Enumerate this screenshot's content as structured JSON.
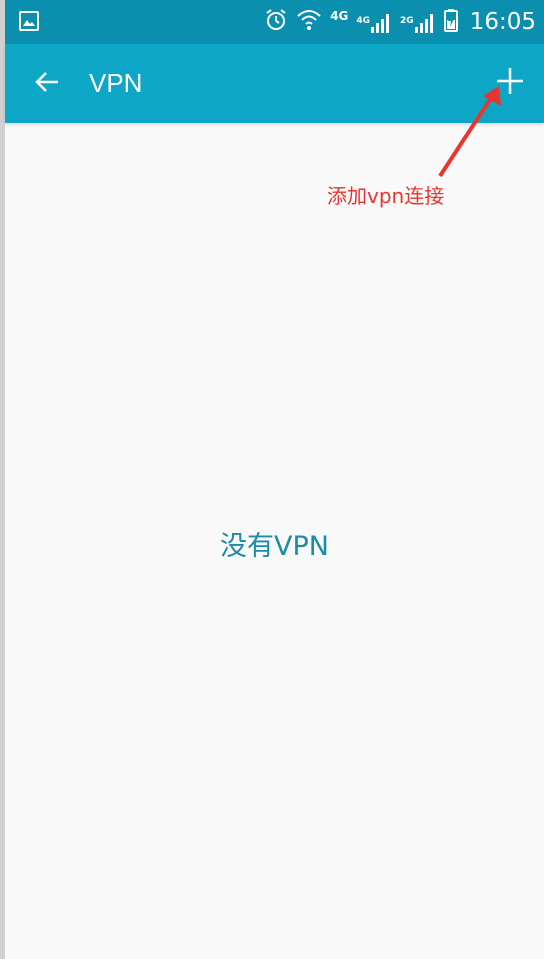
{
  "status_bar": {
    "time": "16:05",
    "network_label": "4G",
    "sim1_label": "4G",
    "sim2_label": "2G",
    "icons": [
      "gallery-icon",
      "alarm-icon",
      "wifi-icon",
      "signal-icon",
      "battery-charging-icon"
    ]
  },
  "app_bar": {
    "title": "VPN",
    "back_icon": "arrow-back-icon",
    "add_icon": "plus-icon"
  },
  "annotation": {
    "text": "添加vpn连接",
    "color": "#e8352f"
  },
  "empty_state": {
    "message": "没有VPN"
  },
  "colors": {
    "status_bar": "#0a8fae",
    "app_bar": "#0ea6c6",
    "accent_text": "#1a8ca6",
    "background": "#f9f9f9"
  }
}
